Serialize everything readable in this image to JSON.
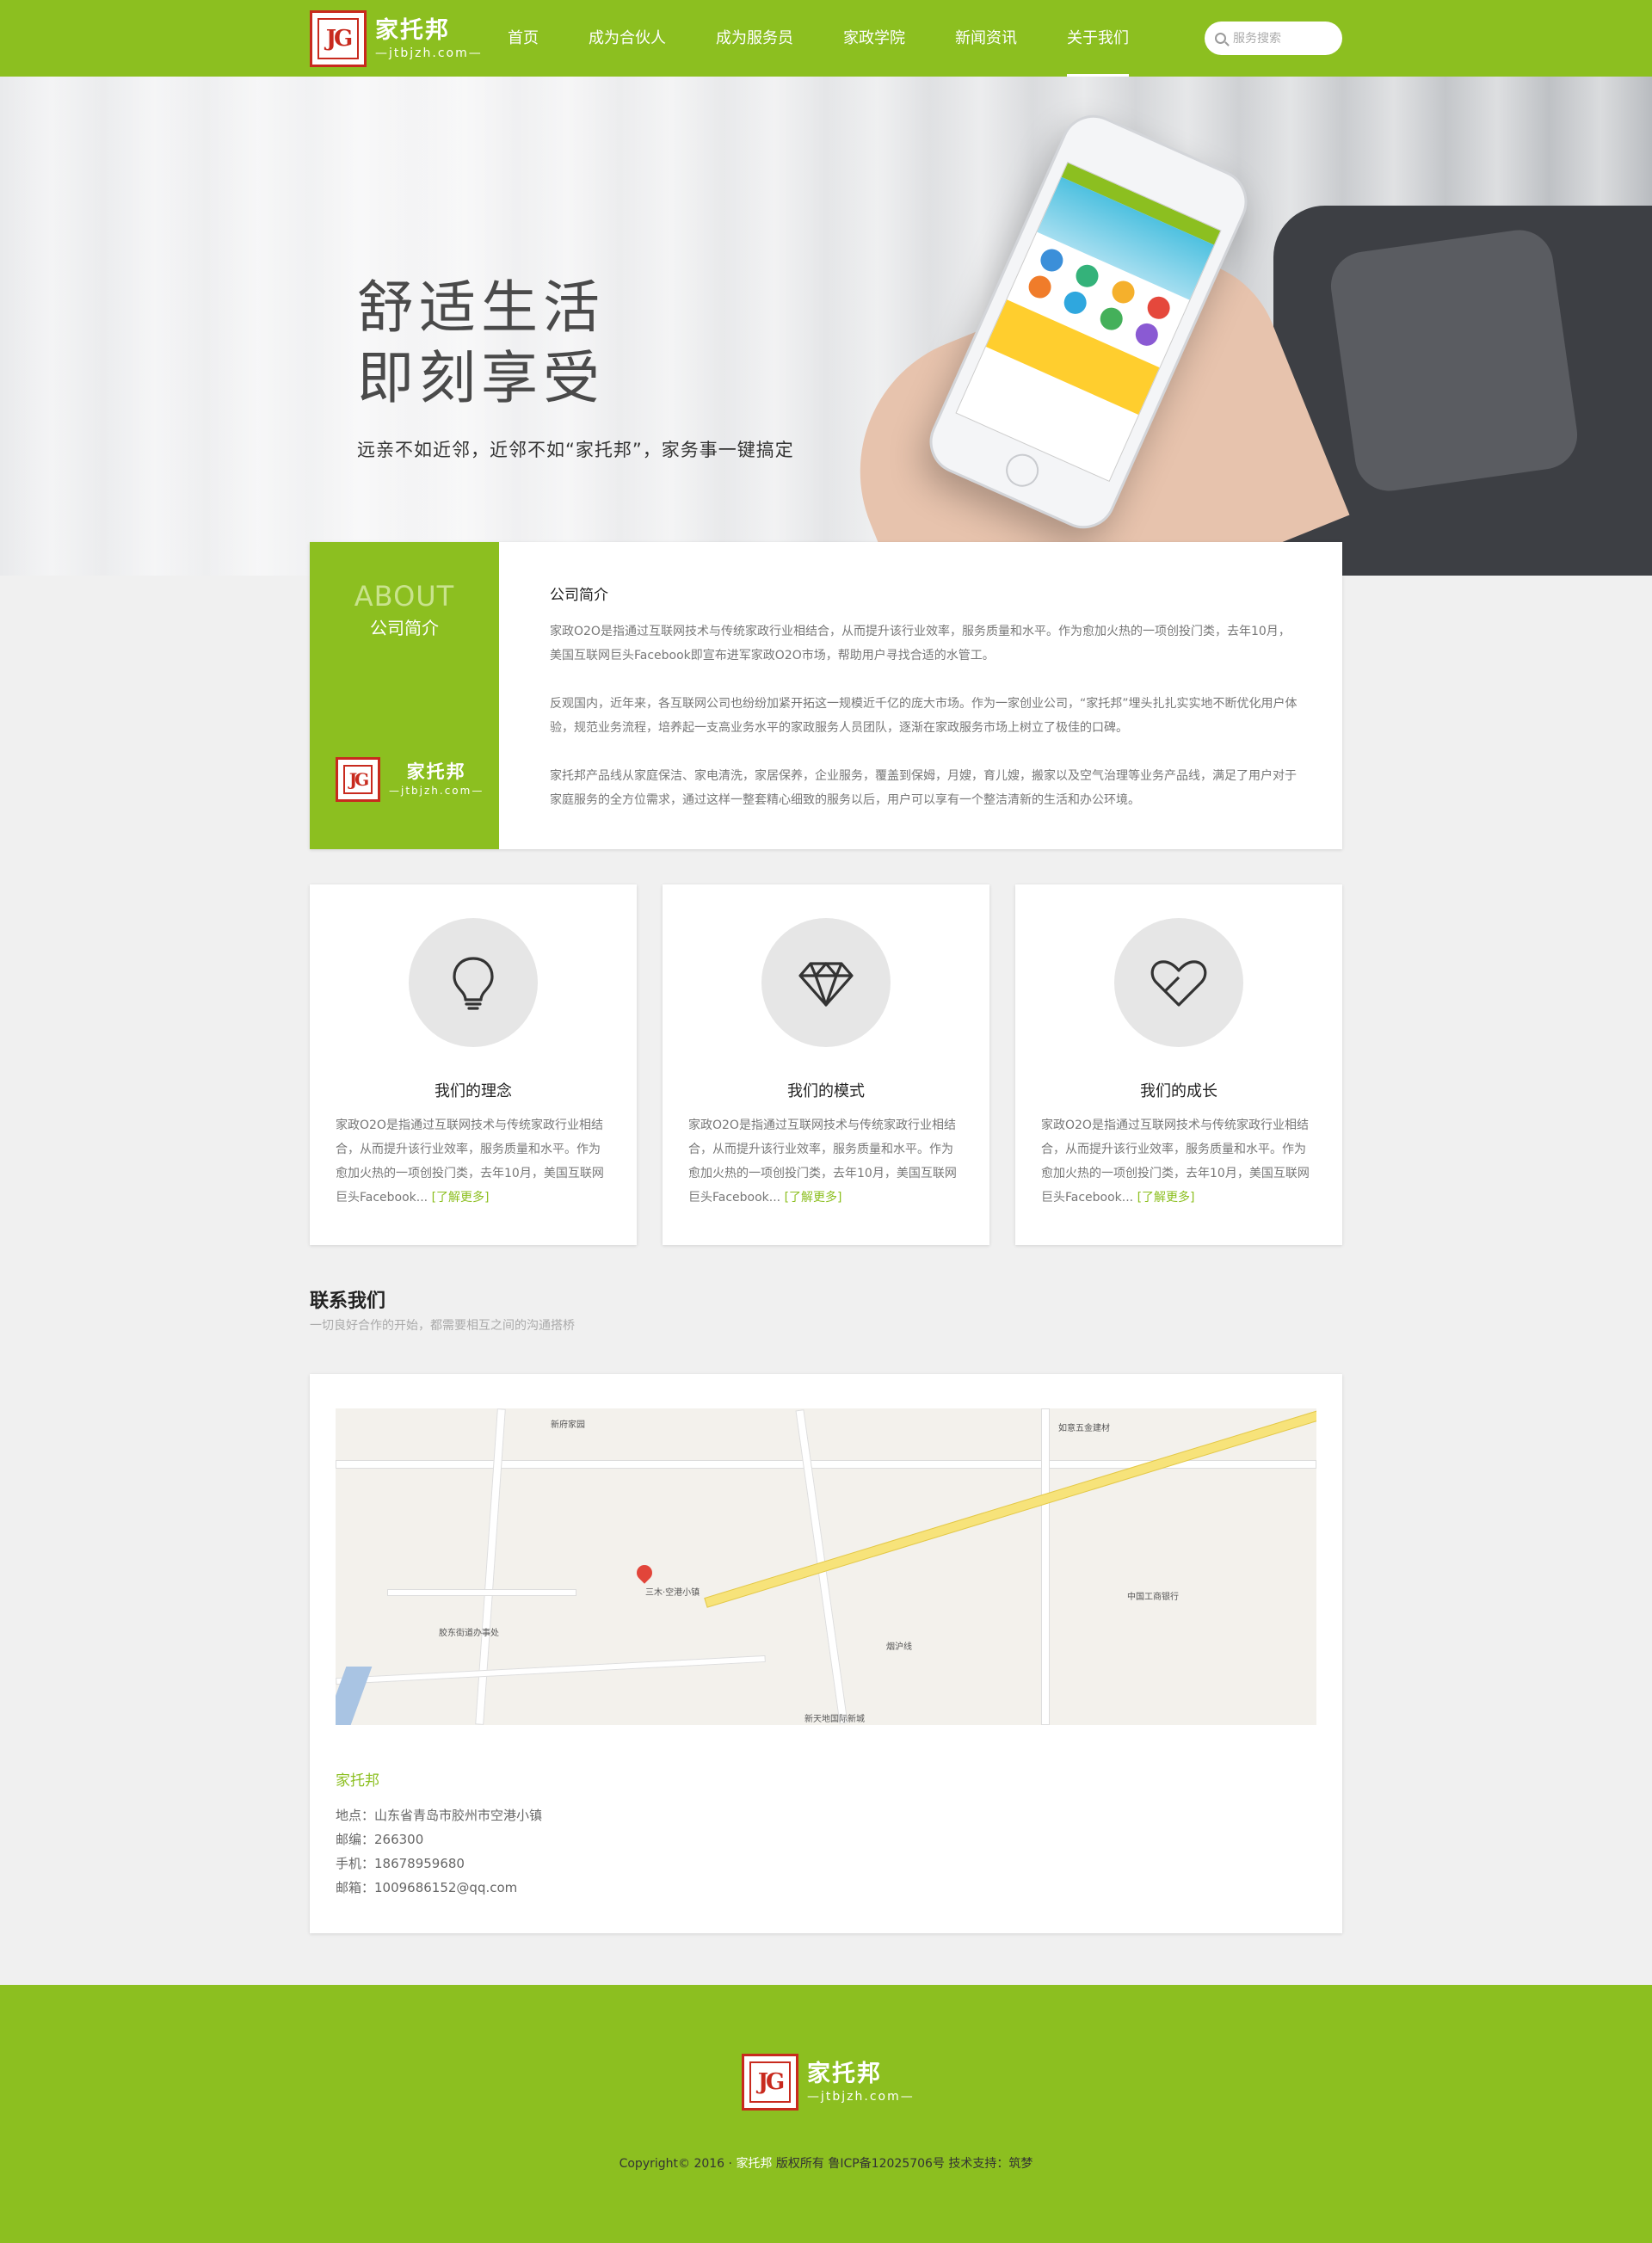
{
  "header": {
    "logo_name": "家托邦",
    "logo_domain": "—jtbjzh.com—",
    "nav": [
      {
        "label": "首页"
      },
      {
        "label": "成为合伙人"
      },
      {
        "label": "成为服务员"
      },
      {
        "label": "家政学院"
      },
      {
        "label": "新闻资讯"
      },
      {
        "label": "关于我们",
        "active": true
      }
    ],
    "search_placeholder": "服务搜索"
  },
  "hero": {
    "title_line1": "舒适生活",
    "title_line2": "即刻享受",
    "subtitle": "远亲不如近邻，近邻不如“家托邦”，家务事一键搞定"
  },
  "about": {
    "en_label": "ABOUT",
    "cn_label": "公司简介",
    "logo_name": "家托邦",
    "logo_domain": "—jtbjzh.com—",
    "title": "公司简介",
    "paragraphs": [
      "家政O2O是指通过互联网技术与传统家政行业相结合，从而提升该行业效率，服务质量和水平。作为愈加火热的一项创投门类，去年10月，美国互联网巨头Facebook即宣布进军家政O2O市场，帮助用户寻找合适的水管工。",
      "反观国内，近年来，各互联网公司也纷纷加紧开拓这一规模近千亿的庞大市场。作为一家创业公司，“家托邦”埋头扎扎实实地不断优化用户体验，规范业务流程，培养起一支高业务水平的家政服务人员团队，逐渐在家政服务市场上树立了极佳的口碑。",
      "家托邦产品线从家庭保洁、家电清洗，家居保养，企业服务，覆盖到保姆，月嫂，育儿嫂，搬家以及空气治理等业务产品线，满足了用户对于家庭服务的全方位需求，通过这样一整套精心细致的服务以后，用户可以享有一个整洁清新的生活和办公环境。"
    ]
  },
  "cards": [
    {
      "icon": "lightbulb-icon",
      "title": "我们的理念",
      "text": "家政O2O是指通过互联网技术与传统家政行业相结合，从而提升该行业效率，服务质量和水平。作为愈加火热的一项创投门类，去年10月，美国互联网巨头Facebook...",
      "more": "[了解更多]"
    },
    {
      "icon": "diamond-icon",
      "title": "我们的模式",
      "text": "家政O2O是指通过互联网技术与传统家政行业相结合，从而提升该行业效率，服务质量和水平。作为愈加火热的一项创投门类，去年10月，美国互联网巨头Facebook...",
      "more": "[了解更多]"
    },
    {
      "icon": "heart-icon",
      "title": "我们的成长",
      "text": "家政O2O是指通过互联网技术与传统家政行业相结合，从而提升该行业效率，服务质量和水平。作为愈加火热的一项创投门类，去年10月，美国互联网巨头Facebook...",
      "more": "[了解更多]"
    }
  ],
  "contact": {
    "title": "联系我们",
    "subtitle": "一切良好合作的开始，都需要相互之间的沟通搭桥",
    "company": "家托邦",
    "address": "地点：山东省青岛市胶州市空港小镇",
    "postcode": "邮编：266300",
    "phone": "手机：18678959680",
    "email": "邮箱：1009686152@qq.com",
    "map_labels": {
      "xinfu": "新府家园",
      "kongxiang": "三木·空港小镇",
      "jiaodong": "胶东街道办事处",
      "xintiandi": "新天地国际新城",
      "gonghang": "中国工商银行",
      "ruyi": "如意五金建材",
      "yanhu": "烟沪线"
    }
  },
  "footer": {
    "logo_name": "家托邦",
    "logo_domain": "—jtbjzh.com—",
    "copy_prefix": "Copyright© 2016 ·",
    "copy_brand": "家托邦",
    "copy_suffix": "版权所有 鲁ICP备12025706号 技术支持：筑梦"
  },
  "colors": {
    "brand_green": "#8cbf20",
    "logo_red": "#c82a1e"
  }
}
